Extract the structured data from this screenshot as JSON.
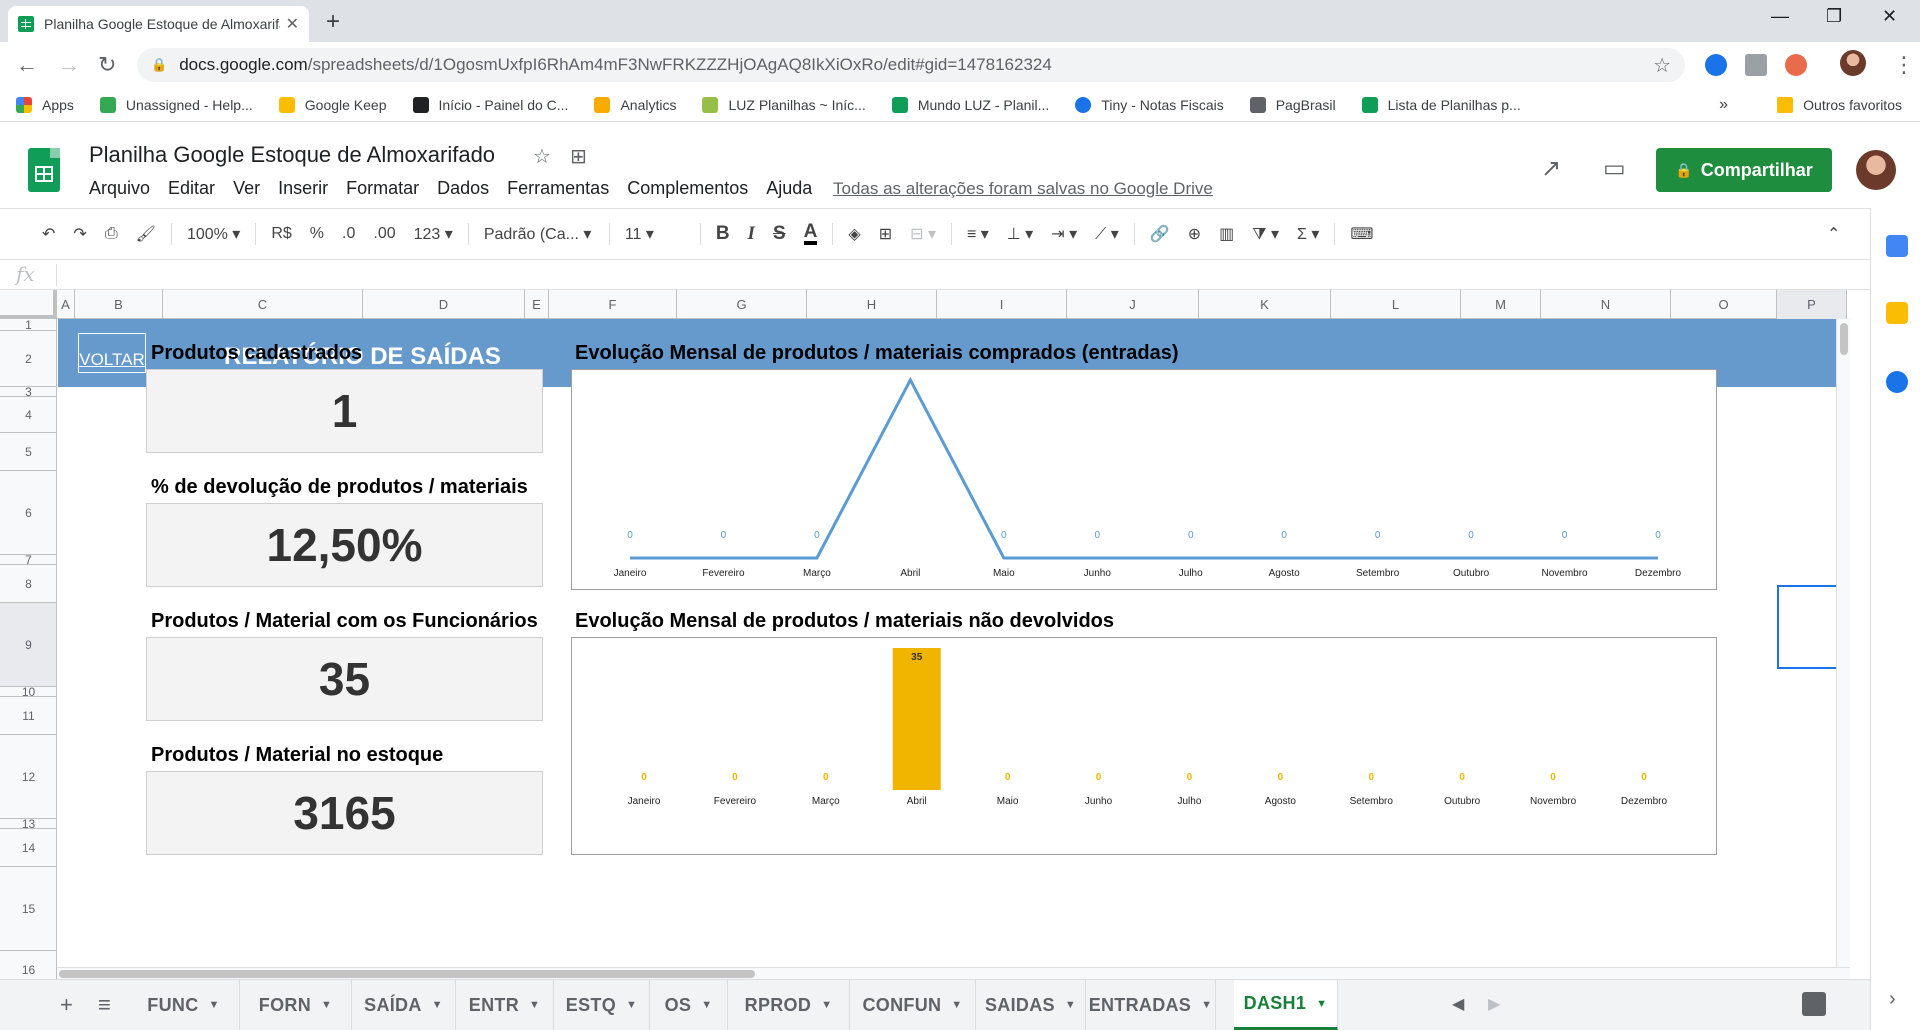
{
  "browser": {
    "tab_title": "Planilha Google Estoque de Almoxarifado - Google Sheets",
    "url_host": "docs.google.com",
    "url_path": "/spreadsheets/d/1OgosmUxfpI6RhAm4mF3NwFRKZZZHjOAgAQ8IkXiOxRo/edit#gid=1478162324",
    "bookmarks": [
      {
        "label": "Apps",
        "color": "#ea4335"
      },
      {
        "label": "Unassigned - Help...",
        "color": "#34a853"
      },
      {
        "label": "Google Keep",
        "color": "#fbbc04"
      },
      {
        "label": "Início - Painel do C...",
        "color": "#202124"
      },
      {
        "label": "Analytics",
        "color": "#f9ab00"
      },
      {
        "label": "LUZ Planilhas ~ Iníc...",
        "color": "#0f9d58"
      },
      {
        "label": "Mundo LUZ - Planil...",
        "color": "#0f9d58"
      },
      {
        "label": "Tiny - Notas Fiscais",
        "color": "#1a73e8"
      },
      {
        "label": "PagBrasil",
        "color": "#5f6368"
      },
      {
        "label": "Lista de Planilhas p...",
        "color": "#0f9d58"
      }
    ],
    "bookmarks_more": "»",
    "other_bookmarks": "Outros favoritos"
  },
  "doc": {
    "title": "Planilha Google Estoque de Almoxarifado",
    "menu": [
      "Arquivo",
      "Editar",
      "Ver",
      "Inserir",
      "Formatar",
      "Dados",
      "Ferramentas",
      "Complementos",
      "Ajuda"
    ],
    "save_status": "Todas as alterações foram salvas no Google Drive",
    "share_label": "Compartilhar"
  },
  "toolbar": {
    "zoom": "100%",
    "currency": "R$",
    "percent": "%",
    "dec_less": ".0",
    "dec_more": ".00",
    "format_more": "123",
    "font": "Padrão (Ca...",
    "font_size": "11"
  },
  "columns": [
    "A",
    "B",
    "C",
    "D",
    "E",
    "F",
    "G",
    "H",
    "I",
    "J",
    "K",
    "L",
    "M",
    "N",
    "O",
    "P"
  ],
  "rows": [
    "1",
    "2",
    "3",
    "4",
    "5",
    "6",
    "7",
    "8",
    "9",
    "10",
    "11",
    "12",
    "13",
    "14",
    "15",
    "16"
  ],
  "report": {
    "back_link": "VOLTAR",
    "title": "RELATÓRIO DE SAÍDAS",
    "kpis": [
      {
        "label": "Produtos cadastrados",
        "value": "1"
      },
      {
        "label": "% de devolução de produtos / materiais",
        "value": "12,50%"
      },
      {
        "label": "Produtos / Material com os Funcionários",
        "value": "35"
      },
      {
        "label": "Produtos / Material no estoque",
        "value": "3165"
      }
    ]
  },
  "chart_data": [
    {
      "type": "line",
      "title": "Evolução Mensal de produtos / materiais comprados (entradas)",
      "categories": [
        "Janeiro",
        "Fevereiro",
        "Março",
        "Abril",
        "Maio",
        "Junho",
        "Julho",
        "Agosto",
        "Setembro",
        "Outubro",
        "Novembro",
        "Dezembro"
      ],
      "values": [
        0,
        0,
        0,
        1,
        0,
        0,
        0,
        0,
        0,
        0,
        0,
        0
      ],
      "data_labels": [
        "0",
        "0",
        "0",
        "",
        "0",
        "0",
        "0",
        "0",
        "0",
        "0",
        "0",
        "0"
      ],
      "color": "#5b9bd5"
    },
    {
      "type": "bar",
      "title": "Evolução Mensal de produtos / materiais não devolvidos",
      "categories": [
        "Janeiro",
        "Fevereiro",
        "Março",
        "Abril",
        "Maio",
        "Junho",
        "Julho",
        "Agosto",
        "Setembro",
        "Outubro",
        "Novembro",
        "Dezembro"
      ],
      "values": [
        0,
        0,
        0,
        35,
        0,
        0,
        0,
        0,
        0,
        0,
        0,
        0
      ],
      "color": "#f1b500"
    }
  ],
  "sheet_tabs": [
    "FUNC",
    "FORN",
    "SAÍDA",
    "ENTR",
    "ESTQ",
    "OS",
    "RPROD",
    "CONFUN",
    "SAIDAS",
    "ENTRADAS",
    "DASH1"
  ],
  "active_tab": "DASH1"
}
